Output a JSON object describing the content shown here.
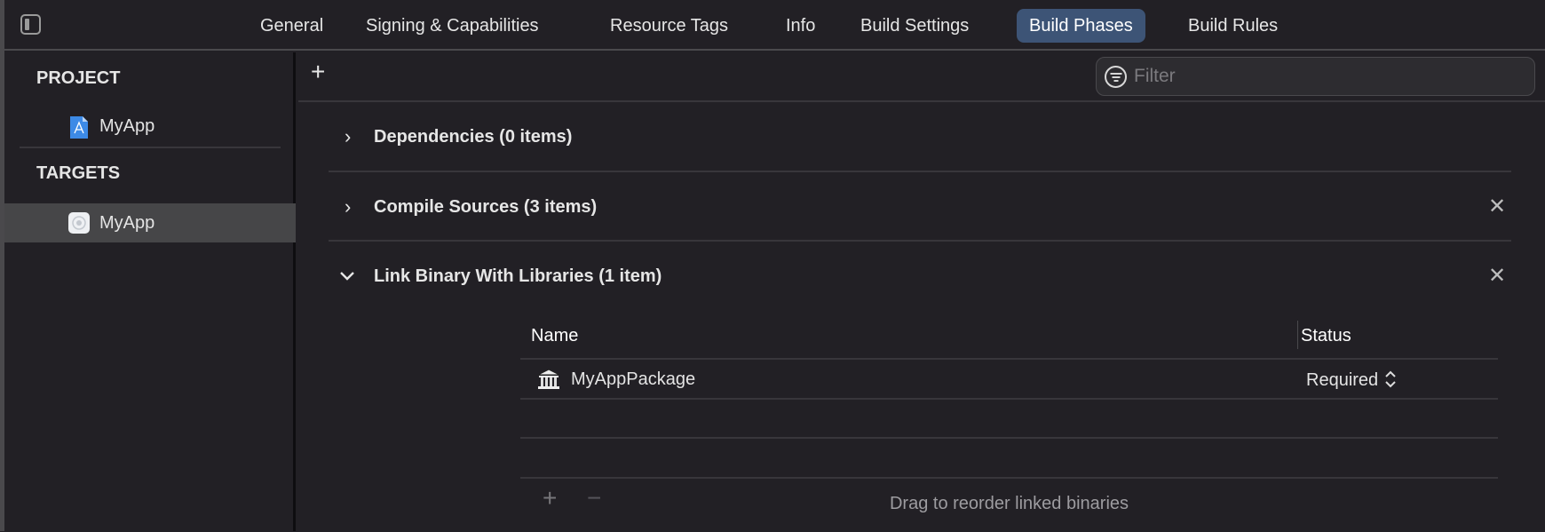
{
  "tabs": [
    "General",
    "Signing & Capabilities",
    "Resource Tags",
    "Info",
    "Build Settings",
    "Build Phases",
    "Build Rules"
  ],
  "active_tab": "Build Phases",
  "sidebar": {
    "project_header": "PROJECT",
    "project_item": "MyApp",
    "targets_header": "TARGETS",
    "target_item": "MyApp"
  },
  "toolbar": {
    "add": "+",
    "filter_placeholder": "Filter"
  },
  "phases": [
    {
      "title": "Dependencies (0 items)",
      "expanded": false
    },
    {
      "title": "Compile Sources (3 items)",
      "expanded": false
    },
    {
      "title": "Link Binary With Libraries (1 item)",
      "expanded": true
    }
  ],
  "table": {
    "col_name": "Name",
    "col_status": "Status",
    "rows": [
      {
        "name": "MyAppPackage",
        "status": "Required"
      }
    ]
  },
  "footer": {
    "add": "+",
    "remove": "−",
    "hint": "Drag to reorder linked binaries"
  },
  "colors": {
    "accent": "#3d5476",
    "background": "#222025",
    "selected_row": "#464648"
  }
}
